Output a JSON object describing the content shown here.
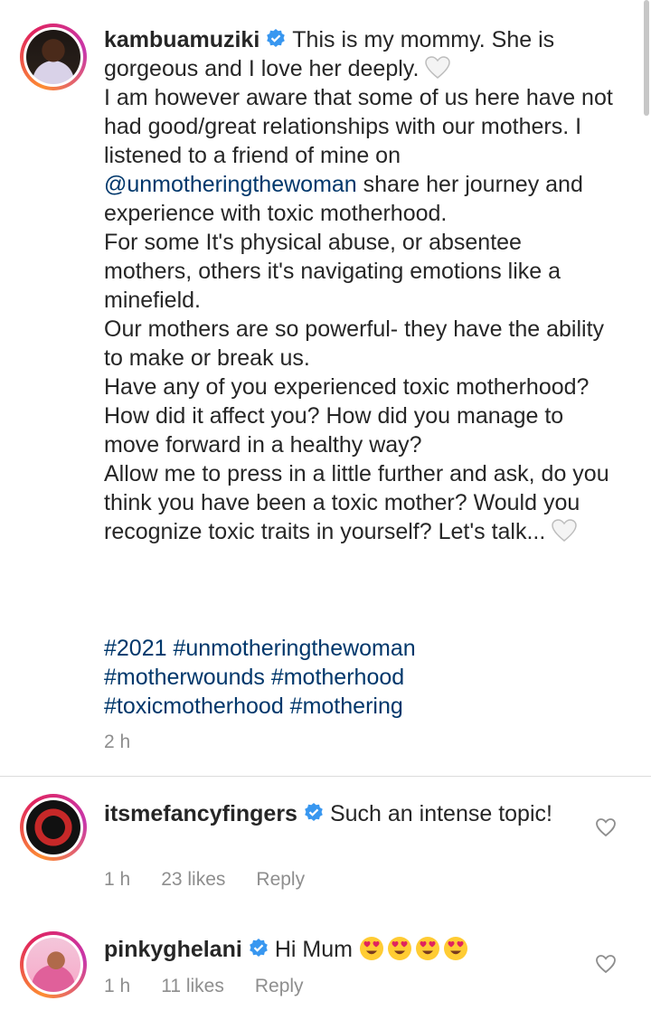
{
  "caption": {
    "username": "kambuamuziki",
    "line1": "This is my mommy. She is gorgeous and I love her deeply.",
    "para2_start": "I am however aware that some of us here have not had good/great relationships with our mothers. I listened to a friend of mine on",
    "mention": "@unmotheringthewoman",
    "para2_end": "share her journey and experience with toxic motherhood.",
    "para3": "For some It's physical abuse, or absentee mothers, others it's navigating emotions like a minefield.",
    "para4": "Our mothers are so powerful- they have the ability to make or break us.",
    "para5": "Have any of you experienced toxic motherhood? How did it affect you? How did you manage to move forward in a healthy way?",
    "para6": "Allow me to press in a little further and ask, do you think you have been a toxic mother? Would you recognize toxic traits in yourself? Let's talk...",
    "hashtags_line1": "#2021 #unmotheringthewoman",
    "hashtags_line2": "#motherwounds #motherhood",
    "hashtags_line3": "#toxicmotherhood  #mothering",
    "time": "2 h"
  },
  "comments": [
    {
      "username": "itsmefancyfingers",
      "text": "Such an intense topic!",
      "time": "1 h",
      "likes": "23 likes",
      "reply": "Reply"
    },
    {
      "username": "pinkyghelani",
      "text": "Hi Mum",
      "time": "1 h",
      "likes": "11 likes",
      "reply": "Reply"
    }
  ],
  "colors": {
    "link": "#00376b",
    "verified": "#3897f0",
    "meta": "#8e8e8e"
  },
  "icons": [
    "verified-badge-icon",
    "white-heart-emoji-icon",
    "heart-eyes-emoji-icon",
    "like-heart-icon"
  ]
}
